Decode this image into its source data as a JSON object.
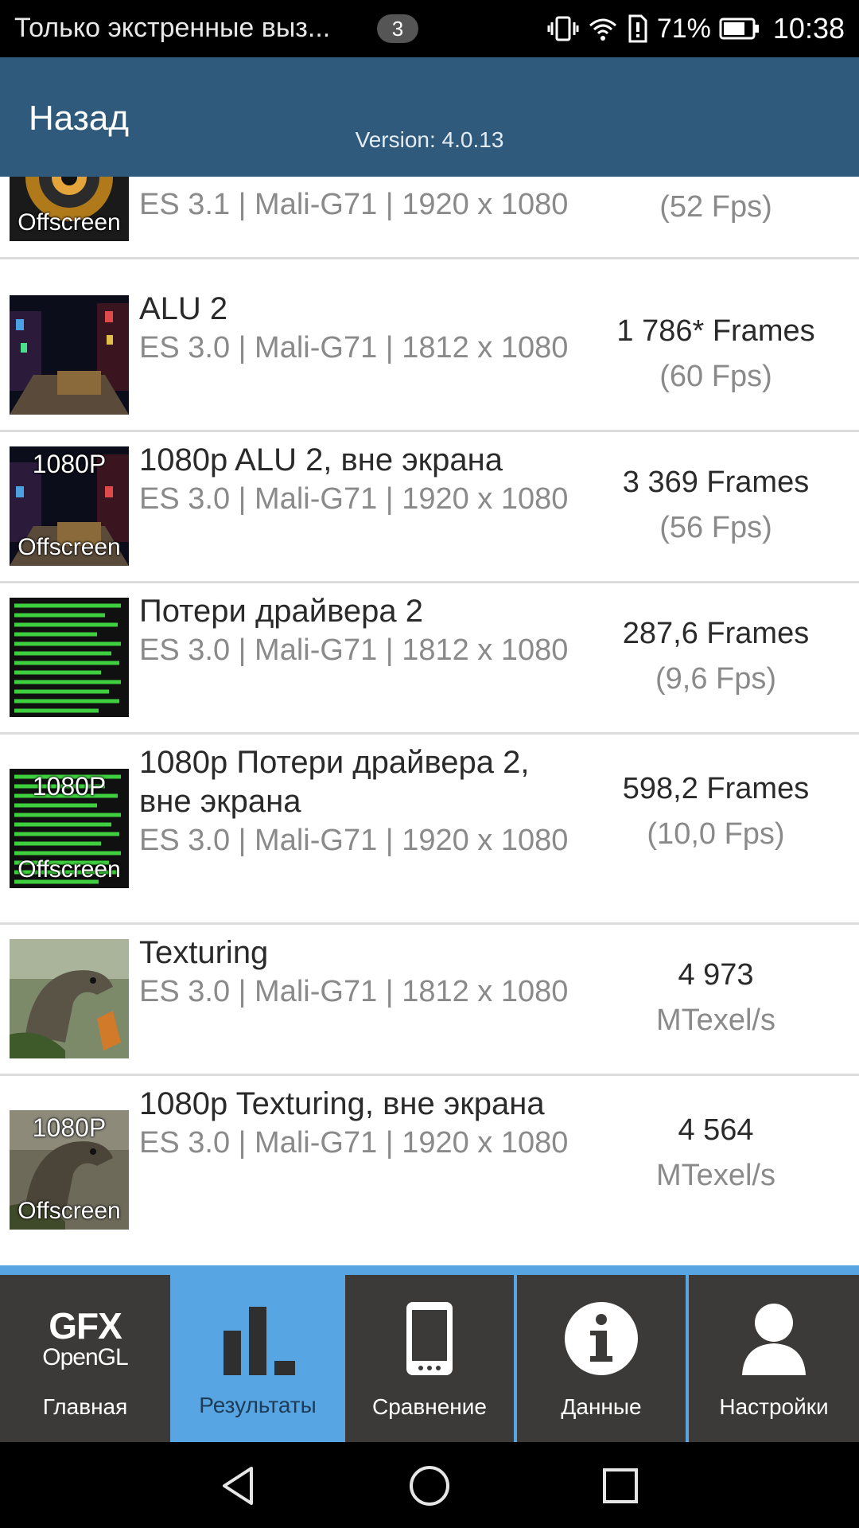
{
  "status_bar": {
    "carrier_text": "Только экстренные выз...",
    "notification_count": "3",
    "battery_percent": "71%",
    "time": "10:38",
    "icons": [
      "vibrate-icon",
      "wifi-icon",
      "alert-icon",
      "battery-icon"
    ]
  },
  "header": {
    "back_label": "Назад",
    "version": "Version: 4.0.13",
    "background_color": "#2f5a7b"
  },
  "results": [
    {
      "title": "",
      "subtitle": "ES 3.1 | Mali-G71 | 1920 x 1080",
      "score_main": "",
      "score_sub": "(52 Fps)",
      "thumb_top": "",
      "thumb_bottom": "Offscreen",
      "thumb_icon": "manhattan-offscreen-thumbnail"
    },
    {
      "title": "ALU 2",
      "subtitle": "ES 3.0 | Mali-G71 | 1812 x 1080",
      "score_main": "1 786* Frames",
      "score_sub": "(60 Fps)",
      "thumb_top": "",
      "thumb_bottom": "",
      "thumb_icon": "alu-scene-thumbnail"
    },
    {
      "title": "1080p ALU 2, вне экрана",
      "subtitle": "ES 3.0 | Mali-G71 | 1920 x 1080",
      "score_main": "3 369 Frames",
      "score_sub": "(56 Fps)",
      "thumb_top": "1080P",
      "thumb_bottom": "Offscreen",
      "thumb_icon": "alu-scene-thumbnail"
    },
    {
      "title": "Потери драйвера 2",
      "subtitle": "ES 3.0 | Mali-G71 | 1812 x 1080",
      "score_main": "287,6 Frames",
      "score_sub": "(9,6 Fps)",
      "thumb_top": "",
      "thumb_bottom": "",
      "thumb_icon": "driver-overhead-thumbnail"
    },
    {
      "title": "1080p Потери драйвера 2, вне экрана",
      "subtitle": "ES 3.0 | Mali-G71 | 1920 x 1080",
      "score_main": "598,2 Frames",
      "score_sub": "(10,0 Fps)",
      "thumb_top": "1080P",
      "thumb_bottom": "Offscreen",
      "thumb_icon": "driver-overhead-thumbnail"
    },
    {
      "title": "Texturing",
      "subtitle": "ES 3.0 | Mali-G71 | 1812 x 1080",
      "score_main": "4 973",
      "score_sub": "MTexel/s",
      "thumb_top": "",
      "thumb_bottom": "",
      "thumb_icon": "dinosaur-thumbnail"
    },
    {
      "title": "1080p Texturing, вне экрана",
      "subtitle": "ES 3.0 | Mali-G71 | 1920 x 1080",
      "score_main": "4 564",
      "score_sub": "MTexel/s",
      "thumb_top": "1080P",
      "thumb_bottom": "Offscreen",
      "thumb_icon": "dinosaur-thumbnail"
    }
  ],
  "tabs": [
    {
      "id": "home",
      "label": "Главная",
      "logo_line1": "GFX",
      "logo_line2": "OpenGL",
      "icon": "gfx-opengl-logo",
      "active": false
    },
    {
      "id": "results",
      "label": "Результаты",
      "icon": "bar-chart-icon",
      "active": true
    },
    {
      "id": "compare",
      "label": "Сравнение",
      "icon": "phone-icon",
      "active": false
    },
    {
      "id": "info",
      "label": "Данные",
      "icon": "info-icon",
      "active": false
    },
    {
      "id": "settings",
      "label": "Настройки",
      "icon": "user-icon",
      "active": false
    }
  ],
  "colors": {
    "tab_active": "#57a6e3",
    "tab_inactive": "#3b3a38",
    "text_secondary": "#8a8a8a"
  },
  "nav": {
    "icons": [
      "back-triangle-icon",
      "home-circle-icon",
      "recents-square-icon"
    ]
  }
}
